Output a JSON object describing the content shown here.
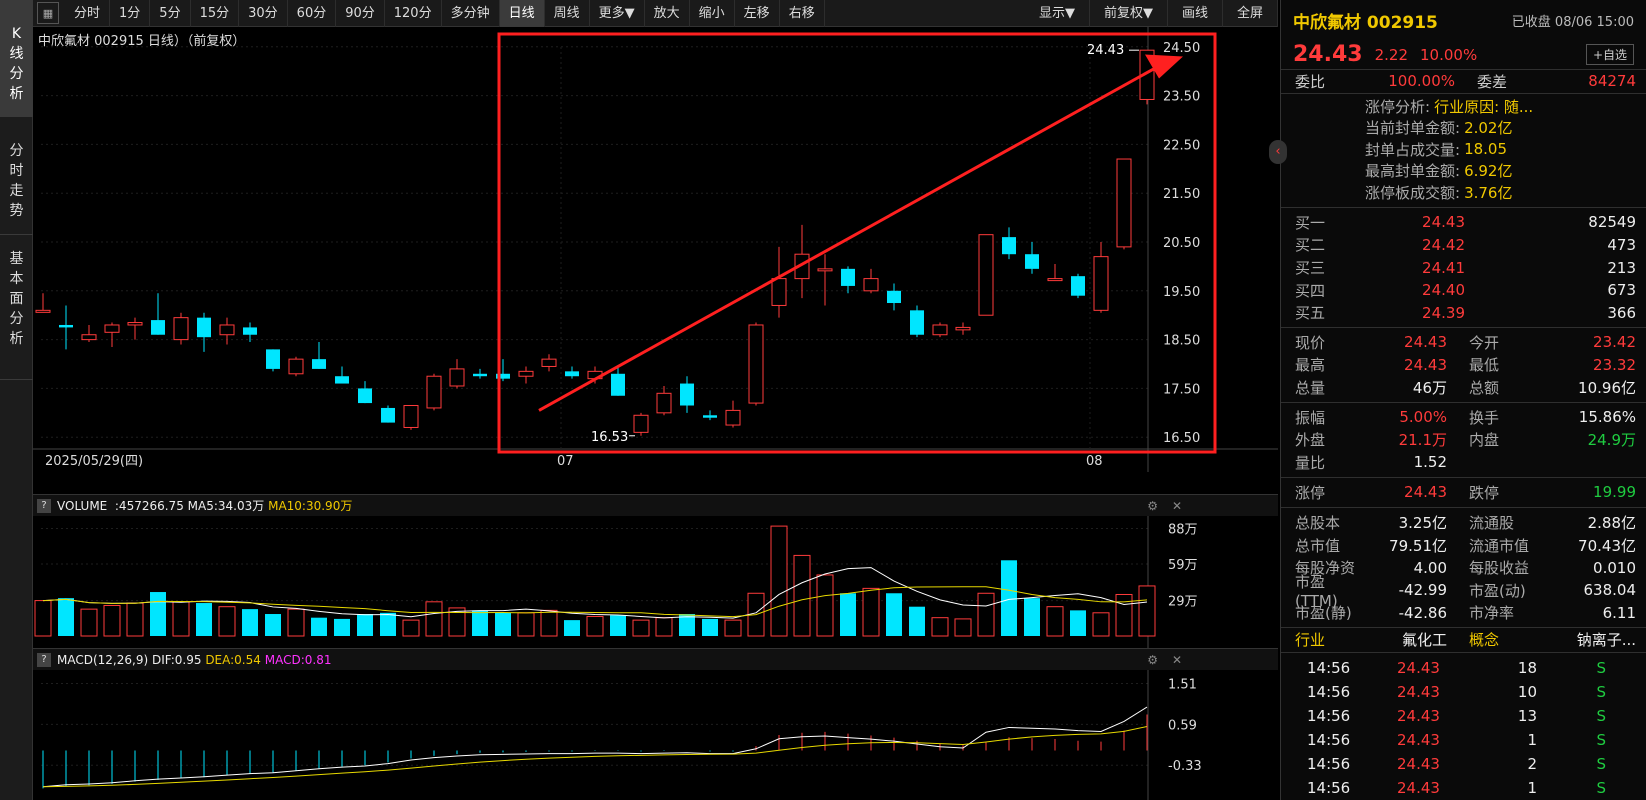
{
  "window_tabs": {
    "kline": "K线分析",
    "intraday": "分时走势",
    "fundamental": "基本面分析"
  },
  "toolbar": {
    "periods": [
      "分时",
      "1分",
      "5分",
      "15分",
      "30分",
      "60分",
      "90分",
      "120分",
      "多分钟",
      "日线",
      "周线",
      "更多▼",
      "放大",
      "缩小",
      "左移",
      "右移"
    ],
    "active_period": "日线",
    "right": [
      "显示▼",
      "前复权▼",
      "画线",
      "全屏"
    ]
  },
  "chart": {
    "title": "中欣氟材 002915 日线）（前复权）",
    "price_labels": [
      "24.50",
      "23.50",
      "22.50",
      "21.50",
      "20.50",
      "19.50",
      "18.50",
      "17.50",
      "16.50"
    ],
    "date_labels": [
      "2025/05/29(四)",
      "07",
      "08"
    ],
    "high_marker": "24.43",
    "low_marker": "16.53",
    "colors": {
      "up": "#ff3b3b",
      "down": "#00e6ff",
      "ma5": "#ffffff",
      "ma10": "#e6d800",
      "highlight": "#ff2020"
    }
  },
  "volume_panel": {
    "label": "VOLUME",
    "vol": ":457266.75",
    "ma5": "MA5:34.03万",
    "ma10": "MA10:30.90万",
    "axis": [
      "88万",
      "59万",
      "29万"
    ]
  },
  "macd_panel": {
    "label": "MACD(12,26,9)",
    "dif": "DIF:0.95",
    "dea": "DEA:0.54",
    "macd": "MACD:0.81",
    "axis": [
      "1.51",
      "0.59",
      "-0.33"
    ]
  },
  "chart_data": {
    "type": "candlestick",
    "ohlc": [
      [
        19.1,
        19.45,
        19.1,
        19.1
      ],
      [
        18.8,
        19.2,
        18.3,
        18.75
      ],
      [
        18.5,
        18.8,
        18.45,
        18.6
      ],
      [
        18.65,
        18.85,
        18.35,
        18.8
      ],
      [
        18.8,
        18.95,
        18.5,
        18.85
      ],
      [
        18.9,
        19.45,
        18.6,
        18.6
      ],
      [
        18.5,
        19.05,
        18.4,
        18.95
      ],
      [
        18.95,
        19.05,
        18.25,
        18.55
      ],
      [
        18.6,
        18.95,
        18.4,
        18.8
      ],
      [
        18.75,
        18.85,
        18.45,
        18.6
      ],
      [
        18.3,
        18.3,
        17.85,
        17.9
      ],
      [
        17.8,
        18.15,
        17.75,
        18.1
      ],
      [
        18.1,
        18.45,
        17.9,
        17.9
      ],
      [
        17.75,
        17.95,
        17.6,
        17.6
      ],
      [
        17.5,
        17.65,
        17.2,
        17.2
      ],
      [
        17.1,
        17.15,
        16.8,
        16.8
      ],
      [
        16.7,
        17.1,
        16.65,
        17.15
      ],
      [
        17.1,
        17.8,
        17.05,
        17.75
      ],
      [
        17.55,
        18.1,
        17.5,
        17.9
      ],
      [
        17.8,
        17.9,
        17.7,
        17.75
      ],
      [
        17.8,
        18.1,
        17.65,
        17.7
      ],
      [
        17.75,
        17.95,
        17.6,
        17.85
      ],
      [
        17.95,
        18.2,
        17.85,
        18.1
      ],
      [
        17.85,
        17.95,
        17.7,
        17.75
      ],
      [
        17.7,
        17.95,
        17.6,
        17.85
      ],
      [
        17.8,
        17.95,
        17.35,
        17.35
      ],
      [
        16.6,
        17.0,
        16.53,
        16.95
      ],
      [
        17.0,
        17.55,
        16.95,
        17.4
      ],
      [
        17.6,
        17.75,
        17.0,
        17.15
      ],
      [
        16.95,
        17.05,
        16.85,
        16.9
      ],
      [
        16.75,
        17.25,
        16.7,
        17.05
      ],
      [
        17.2,
        18.85,
        17.15,
        18.8
      ],
      [
        19.2,
        20.4,
        18.95,
        19.75
      ],
      [
        19.75,
        20.85,
        19.35,
        20.25
      ],
      [
        19.95,
        20.25,
        19.2,
        19.95
      ],
      [
        19.95,
        20.0,
        19.45,
        19.6
      ],
      [
        19.5,
        19.95,
        19.45,
        19.75
      ],
      [
        19.5,
        19.65,
        19.1,
        19.25
      ],
      [
        19.1,
        19.2,
        18.55,
        18.6
      ],
      [
        18.6,
        18.85,
        18.55,
        18.8
      ],
      [
        18.7,
        18.85,
        18.6,
        18.75
      ],
      [
        19.0,
        20.65,
        19.0,
        20.65
      ],
      [
        20.6,
        20.8,
        20.15,
        20.25
      ],
      [
        20.25,
        20.5,
        19.85,
        19.95
      ],
      [
        19.75,
        20.05,
        19.7,
        19.75
      ],
      [
        19.8,
        19.85,
        19.35,
        19.4
      ],
      [
        19.1,
        20.5,
        19.05,
        20.2
      ],
      [
        20.4,
        22.2,
        20.35,
        22.2
      ],
      [
        23.42,
        24.43,
        23.32,
        24.43
      ]
    ],
    "volume": [
      29,
      31,
      22,
      25,
      27,
      36,
      28,
      27,
      24,
      22,
      18,
      22,
      15,
      14,
      18,
      19,
      13,
      28,
      23,
      21,
      19,
      19,
      21,
      13,
      16,
      17,
      13,
      15,
      18,
      14,
      13,
      35,
      90,
      66,
      50,
      35,
      39,
      35,
      24,
      15,
      14,
      35,
      62,
      31,
      24,
      21,
      19,
      34,
      41
    ],
    "macd": [
      -0.85,
      -0.8,
      -0.78,
      -0.75,
      -0.7,
      -0.66,
      -0.63,
      -0.6,
      -0.56,
      -0.52,
      -0.5,
      -0.45,
      -0.4,
      -0.36,
      -0.33,
      -0.27,
      -0.18,
      -0.12,
      -0.08,
      -0.05,
      -0.04,
      -0.03,
      -0.02,
      -0.02,
      -0.01,
      -0.01,
      -0.02,
      -0.01,
      0.0,
      -0.02,
      -0.02,
      0.1,
      0.35,
      0.4,
      0.42,
      0.38,
      0.34,
      0.29,
      0.22,
      0.15,
      0.12,
      0.18,
      0.3,
      0.28,
      0.26,
      0.22,
      0.2,
      0.45,
      0.81
    ],
    "title": "中欣氟材 002915 日线"
  },
  "quote": {
    "name": "中欣氟材 002915",
    "status": "已收盘 08/06 15:00",
    "price": "24.43",
    "change": "2.22",
    "pct": "10.00%",
    "watch_btn": "+自选",
    "weibi_label": "委比",
    "weibi": "100.00%",
    "weicha_label": "委差",
    "weicha": "84274",
    "limit_info": [
      {
        "k": "涨停分析:",
        "v": "行业原因: 随..."
      },
      {
        "k": "当前封单金额:",
        "v": "2.02亿"
      },
      {
        "k": "封单占成交量:",
        "v": "18.05"
      },
      {
        "k": "最高封单金额:",
        "v": "6.92亿"
      },
      {
        "k": "涨停板成交额:",
        "v": "3.76亿"
      }
    ],
    "bids": [
      {
        "k": "买一",
        "p": "24.43",
        "v": "82549"
      },
      {
        "k": "买二",
        "p": "24.42",
        "v": "473"
      },
      {
        "k": "买三",
        "p": "24.41",
        "v": "213"
      },
      {
        "k": "买四",
        "p": "24.40",
        "v": "673"
      },
      {
        "k": "买五",
        "p": "24.39",
        "v": "366"
      }
    ],
    "stats1": [
      {
        "k1": "现价",
        "v1": "24.43",
        "k2": "今开",
        "v2": "23.42"
      },
      {
        "k1": "最高",
        "v1": "24.43",
        "k2": "最低",
        "v2": "23.32"
      },
      {
        "k1": "总量",
        "v1": "46万",
        "k2": "总额",
        "v2": "10.96亿"
      }
    ],
    "stats2": [
      {
        "k1": "振幅",
        "v1": "5.00%",
        "k2": "换手",
        "v2": "15.86%"
      },
      {
        "k1": "外盘",
        "v1": "21.1万",
        "k2": "内盘",
        "v2": "24.9万"
      },
      {
        "k1": "量比",
        "v1": "1.52",
        "k2": "",
        "v2": ""
      }
    ],
    "limit_row": {
      "k1": "涨停",
      "v1": "24.43",
      "k2": "跌停",
      "v2": "19.99"
    },
    "fund": [
      {
        "k1": "总股本",
        "v1": "3.25亿",
        "k2": "流通股",
        "v2": "2.88亿"
      },
      {
        "k1": "总市值",
        "v1": "79.51亿",
        "k2": "流通市值",
        "v2": "70.43亿"
      },
      {
        "k1": "每股净资",
        "v1": "4.00",
        "k2": "每股收益",
        "v2": "0.010"
      },
      {
        "k1": "市盈(TTM)",
        "v1": "-42.99",
        "k2": "市盈(动)",
        "v2": "638.04"
      },
      {
        "k1": "市盈(静)",
        "v1": "-42.86",
        "k2": "市净率",
        "v2": "6.11"
      }
    ],
    "industry": {
      "k1": "行业",
      "v1": "氟化工",
      "k2": "概念",
      "v2": "钠离子..."
    },
    "ticks": [
      {
        "t": "14:56",
        "p": "24.43",
        "v": "18",
        "d": "S"
      },
      {
        "t": "14:56",
        "p": "24.43",
        "v": "10",
        "d": "S"
      },
      {
        "t": "14:56",
        "p": "24.43",
        "v": "13",
        "d": "S"
      },
      {
        "t": "14:56",
        "p": "24.43",
        "v": "1",
        "d": "S"
      },
      {
        "t": "14:56",
        "p": "24.43",
        "v": "2",
        "d": "S"
      },
      {
        "t": "14:56",
        "p": "24.43",
        "v": "1",
        "d": "S"
      }
    ]
  }
}
